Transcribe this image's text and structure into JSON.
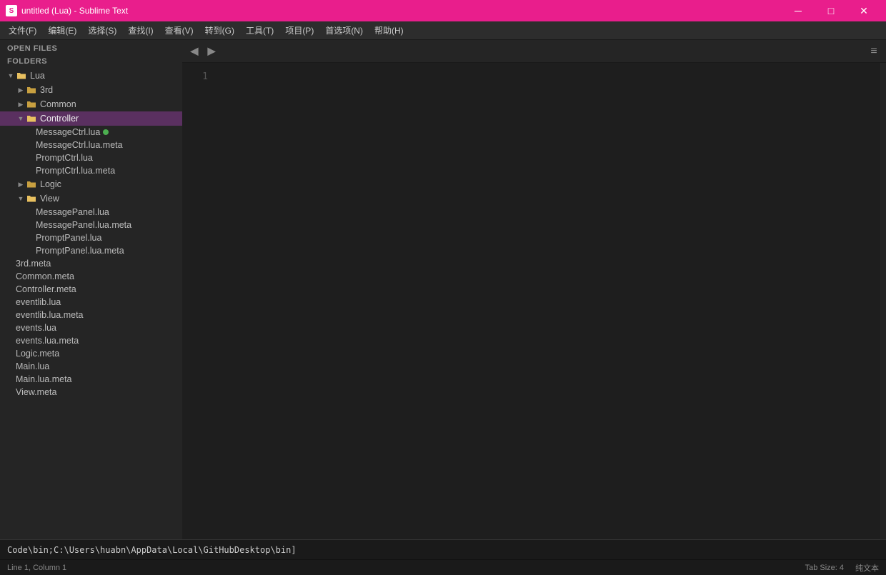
{
  "titlebar": {
    "icon_label": "S",
    "title": "untitled (Lua) - Sublime Text",
    "btn_minimize": "─",
    "btn_maximize": "□",
    "btn_close": "✕"
  },
  "menubar": {
    "items": [
      {
        "label": "文件(F)"
      },
      {
        "label": "编辑(E)"
      },
      {
        "label": "选择(S)"
      },
      {
        "label": "查找(I)"
      },
      {
        "label": "查看(V)"
      },
      {
        "label": "转到(G)"
      },
      {
        "label": "工具(T)"
      },
      {
        "label": "项目(P)"
      },
      {
        "label": "首选项(N)"
      },
      {
        "label": "帮助(H)"
      }
    ]
  },
  "sidebar": {
    "open_files_label": "OPEN FILES",
    "folders_label": "FOLDERS",
    "tree": [
      {
        "id": "lua",
        "level": 0,
        "type": "folder",
        "open": true,
        "label": "Lua"
      },
      {
        "id": "3rd",
        "level": 1,
        "type": "folder",
        "open": false,
        "label": "3rd"
      },
      {
        "id": "common",
        "level": 1,
        "type": "folder",
        "open": false,
        "label": "Common"
      },
      {
        "id": "controller",
        "level": 1,
        "type": "folder",
        "open": true,
        "label": "Controller",
        "highlighted": true
      },
      {
        "id": "messageCtrl",
        "level": 2,
        "type": "file",
        "label": "MessageCtrl.lua",
        "has_dot": true
      },
      {
        "id": "messageCtrlMeta",
        "level": 2,
        "type": "file",
        "label": "MessageCtrl.lua.meta"
      },
      {
        "id": "promptCtrl",
        "level": 2,
        "type": "file",
        "label": "PromptCtrl.lua"
      },
      {
        "id": "promptCtrlMeta",
        "level": 2,
        "type": "file",
        "label": "PromptCtrl.lua.meta"
      },
      {
        "id": "logic",
        "level": 1,
        "type": "folder",
        "open": false,
        "label": "Logic"
      },
      {
        "id": "view",
        "level": 1,
        "type": "folder",
        "open": true,
        "label": "View"
      },
      {
        "id": "messagePanel",
        "level": 2,
        "type": "file",
        "label": "MessagePanel.lua"
      },
      {
        "id": "messagePanelMeta",
        "level": 2,
        "type": "file",
        "label": "MessagePanel.lua.meta"
      },
      {
        "id": "promptPanel",
        "level": 2,
        "type": "file",
        "label": "PromptPanel.lua"
      },
      {
        "id": "promptPanelMeta",
        "level": 2,
        "type": "file",
        "label": "PromptPanel.lua.meta"
      },
      {
        "id": "3rdMeta",
        "level": 0,
        "type": "file",
        "label": "3rd.meta"
      },
      {
        "id": "commonMeta",
        "level": 0,
        "type": "file",
        "label": "Common.meta"
      },
      {
        "id": "controllerMeta",
        "level": 0,
        "type": "file",
        "label": "Controller.meta"
      },
      {
        "id": "eventlibLua",
        "level": 0,
        "type": "file",
        "label": "eventlib.lua"
      },
      {
        "id": "eventlibMeta",
        "level": 0,
        "type": "file",
        "label": "eventlib.lua.meta"
      },
      {
        "id": "eventsLua",
        "level": 0,
        "type": "file",
        "label": "events.lua"
      },
      {
        "id": "eventsMeta",
        "level": 0,
        "type": "file",
        "label": "events.lua.meta"
      },
      {
        "id": "logicMeta",
        "level": 0,
        "type": "file",
        "label": "Logic.meta"
      },
      {
        "id": "mainLua",
        "level": 0,
        "type": "file",
        "label": "Main.lua"
      },
      {
        "id": "mainMeta",
        "level": 0,
        "type": "file",
        "label": "Main.lua.meta"
      },
      {
        "id": "viewMeta",
        "level": 0,
        "type": "file",
        "label": "View.meta"
      }
    ]
  },
  "editor": {
    "tab_prev_label": "◀",
    "tab_next_label": "▶",
    "menu_icon_label": "≡",
    "line_numbers": [
      "1"
    ],
    "code_content": ""
  },
  "statusbar": {
    "position": "Line 1, Column 1",
    "tab_size": "Tab Size: 4",
    "encoding": "纯文本"
  },
  "bottombar": {
    "path": "Code\\bin;C:\\Users\\huabn\\AppData\\Local\\GitHubDesktop\\bin]"
  }
}
